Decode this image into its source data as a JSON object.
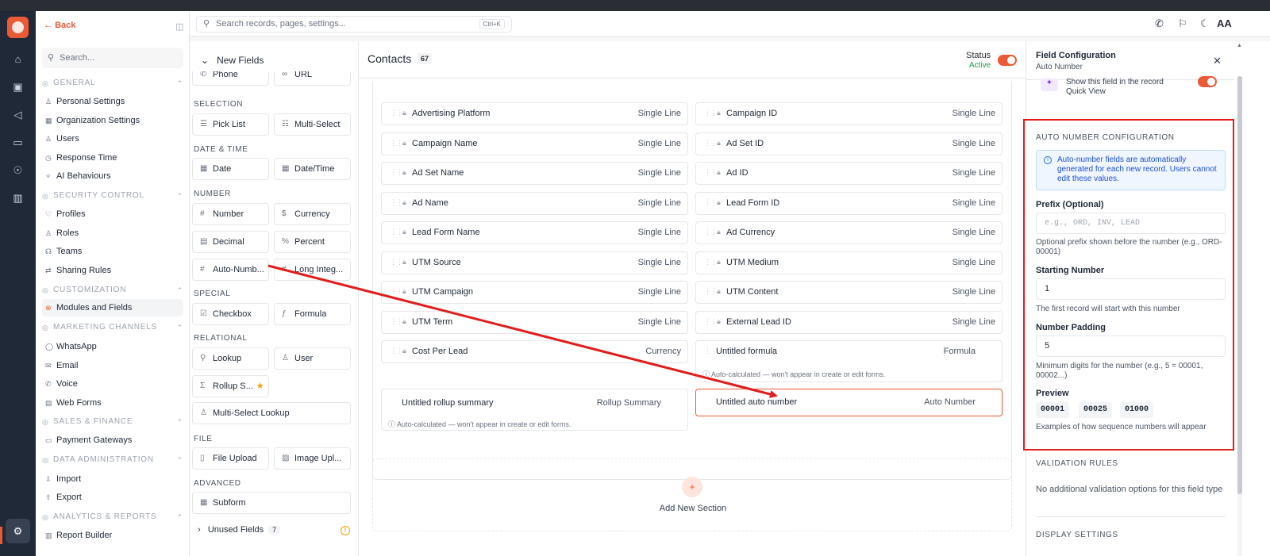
{
  "header": {
    "search_placeholder": "Search records, pages, settings...",
    "shortcut": "Ctrl+K",
    "avatar": "AA"
  },
  "sidebar": {
    "back": "Back",
    "search_placeholder": "Search...",
    "groups": [
      {
        "label": "GENERAL",
        "items": [
          "Personal Settings",
          "Organization Settings",
          "Users",
          "Response Time",
          "AI Behaviours"
        ]
      },
      {
        "label": "SECURITY CONTROL",
        "items": [
          "Profiles",
          "Roles",
          "Teams",
          "Sharing Rules"
        ]
      },
      {
        "label": "CUSTOMIZATION",
        "items": [
          "Modules and Fields"
        ]
      },
      {
        "label": "MARKETING CHANNELS",
        "items": [
          "WhatsApp",
          "Email",
          "Voice",
          "Web Forms"
        ]
      },
      {
        "label": "SALES & FINANCE",
        "items": [
          "Payment Gateways"
        ]
      },
      {
        "label": "DATA ADMINISTRATION",
        "items": [
          "Import",
          "Export"
        ]
      },
      {
        "label": "ANALYTICS & REPORTS",
        "items": [
          "Report Builder"
        ]
      }
    ]
  },
  "palette": {
    "title": "New Fields",
    "clipped": [
      "Phone",
      "URL"
    ],
    "sections": {
      "selection": "SELECTION",
      "datetime": "DATE & TIME",
      "number": "NUMBER",
      "special": "SPECIAL",
      "relational": "RELATIONAL",
      "file": "FILE",
      "advanced": "ADVANCED"
    },
    "chips": {
      "picklist": "Pick List",
      "multiselect": "Multi-Select",
      "date": "Date",
      "datetime": "Date/Time",
      "number": "Number",
      "currency": "Currency",
      "decimal": "Decimal",
      "percent": "Percent",
      "autonumber": "Auto-Numb...",
      "longint": "Long Integ...",
      "checkbox": "Checkbox",
      "formula": "Formula",
      "lookup": "Lookup",
      "user": "User",
      "rollup": "Rollup S...",
      "msl": "Multi-Select Lookup",
      "fileupload": "File Upload",
      "imageupload": "Image Upl...",
      "subform": "Subform"
    },
    "unused_label": "Unused Fields",
    "unused_count": "7"
  },
  "main": {
    "title": "Contacts",
    "count": "67",
    "status_label": "Status",
    "status_value": "Active",
    "fields_left": [
      {
        "name": "Advertising Platform",
        "type": "Single Line"
      },
      {
        "name": "Campaign Name",
        "type": "Single Line"
      },
      {
        "name": "Ad Set Name",
        "type": "Single Line"
      },
      {
        "name": "Ad Name",
        "type": "Single Line"
      },
      {
        "name": "Lead Form Name",
        "type": "Single Line"
      },
      {
        "name": "UTM Source",
        "type": "Single Line"
      },
      {
        "name": "UTM Campaign",
        "type": "Single Line"
      },
      {
        "name": "UTM Term",
        "type": "Single Line"
      },
      {
        "name": "Cost Per Lead",
        "type": "Currency"
      }
    ],
    "fields_right": [
      {
        "name": "Campaign ID",
        "type": "Single Line"
      },
      {
        "name": "Ad Set ID",
        "type": "Single Line"
      },
      {
        "name": "Ad ID",
        "type": "Single Line"
      },
      {
        "name": "Lead Form ID",
        "type": "Single Line"
      },
      {
        "name": "Ad Currency",
        "type": "Single Line"
      },
      {
        "name": "UTM Medium",
        "type": "Single Line"
      },
      {
        "name": "UTM Content",
        "type": "Single Line"
      },
      {
        "name": "External Lead ID",
        "type": "Single Line"
      }
    ],
    "formula_field": {
      "name": "Untitled formula",
      "type": "Formula",
      "note": "Auto-calculated — won't appear in create or edit forms."
    },
    "rollup_field": {
      "name": "Untitled rollup summary",
      "type": "Rollup Summary",
      "note": "Auto-calculated — won't appear in create or edit forms."
    },
    "autonumber_field": {
      "name": "Untitled auto number",
      "type": "Auto Number"
    },
    "add_section": "Add New Section"
  },
  "config": {
    "title": "Field Configuration",
    "subtitle": "Auto Number",
    "quick_view": "Show this field in the record Quick View",
    "section_title": "AUTO NUMBER CONFIGURATION",
    "info": "Auto-number fields are automatically generated for each new record. Users cannot edit these values.",
    "prefix_label": "Prefix (Optional)",
    "prefix_placeholder": "e.g., ORD, INV, LEAD",
    "prefix_help": "Optional prefix shown before the number (e.g., ORD-00001)",
    "start_label": "Starting Number",
    "start_value": "1",
    "start_help": "The first record will start with this number",
    "padding_label": "Number Padding",
    "padding_value": "5",
    "padding_help": "Minimum digits for the number (e.g., 5 = 00001, 00002...)",
    "preview_label": "Preview",
    "preview_values": [
      "00001",
      "00025",
      "01000"
    ],
    "preview_help": "Examples of how sequence numbers will appear",
    "validation_title": "VALIDATION RULES",
    "validation_text": "No additional validation options for this field type",
    "display_title": "DISPLAY SETTINGS"
  },
  "colors": {
    "accent": "#ea5b35",
    "annotation": "#e11d1d",
    "active_green": "#16a34a"
  }
}
